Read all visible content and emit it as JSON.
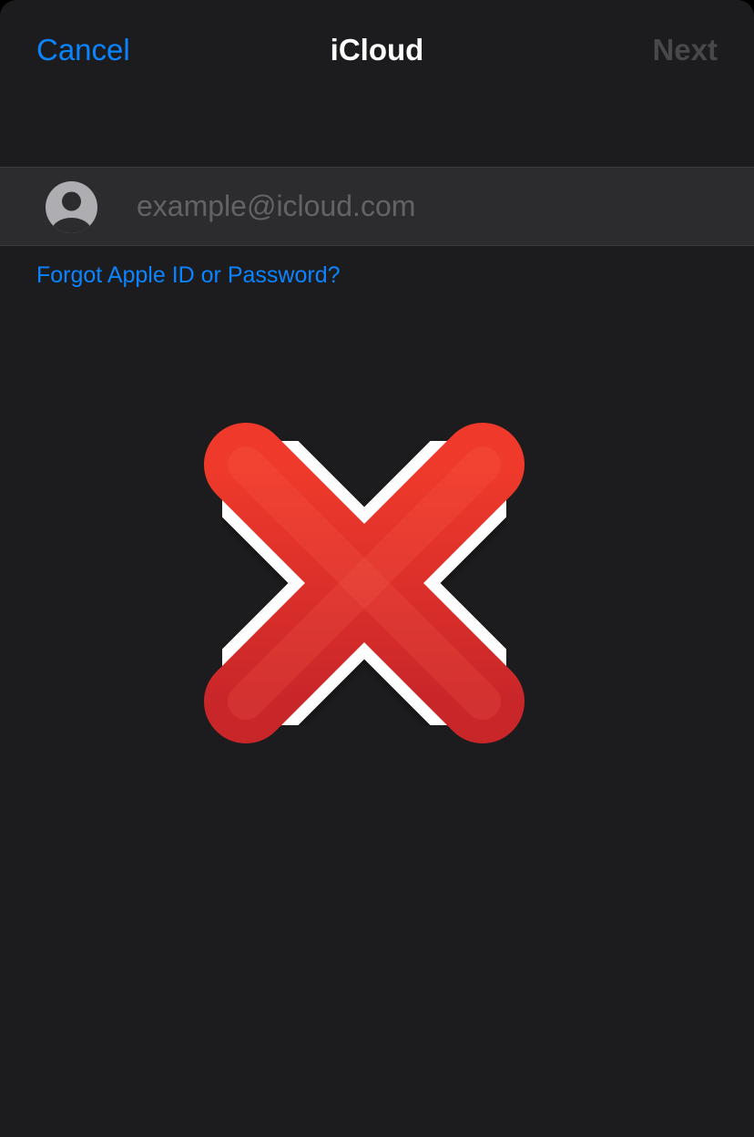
{
  "nav": {
    "cancel_label": "Cancel",
    "title": "iCloud",
    "next_label": "Next"
  },
  "form": {
    "email_placeholder": "example@icloud.com",
    "email_value": "",
    "forgot_link": "Forgot Apple ID or Password?"
  },
  "icons": {
    "field_icon": "person-circle-icon",
    "overlay_icon": "cross-mark-icon"
  },
  "colors": {
    "accent": "#0a84ff",
    "background": "#1c1c1e",
    "field_background": "#2c2c2e",
    "disabled_text": "#48484a",
    "cross_red": "#d72e26"
  }
}
